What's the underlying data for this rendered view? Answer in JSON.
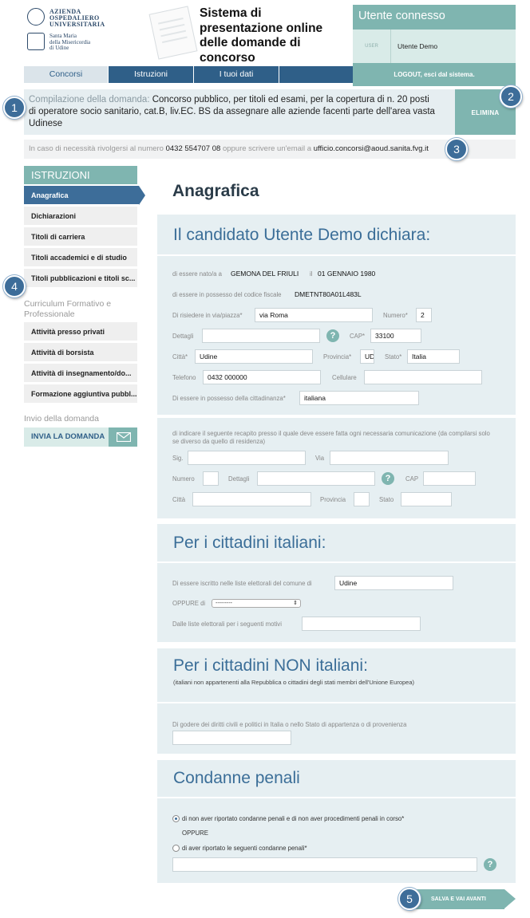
{
  "logo": {
    "org_lines": [
      "AZIENDA",
      "OSPEDALIERO",
      "UNIVERSITARIA"
    ],
    "hospital_lines": [
      "Santa Maria",
      "della Misericordia",
      "di Udine"
    ]
  },
  "app_title": "Sistema di presentazione online delle domande di concorso",
  "user_panel": {
    "title": "Utente connesso",
    "user_label": "USER",
    "user_name": "Utente Demo",
    "logout": "LOGOUT, esci dal sistema."
  },
  "tabs": [
    {
      "label": "Concorsi",
      "active": true
    },
    {
      "label": "Istruzioni",
      "active": false
    },
    {
      "label": "I tuoi dati",
      "active": false
    },
    {
      "label": "",
      "active": false
    }
  ],
  "notice": {
    "lead": "Compilazione della domanda:",
    "text": "Concorso pubblico, per titoli ed esami, per la copertura di n. 20 posti di operatore socio sanitario, cat.B, liv.EC. BS da assegnare alle aziende facenti parte dell'area vasta Udinese",
    "delete": "ELIMINA"
  },
  "contact": {
    "prefix": "In caso di necessità rivolgersi al numero",
    "phone": "0432 554707 08",
    "middle": "oppure scrivere un'email a",
    "email": "ufficio.concorsi@aoud.sanita.fvg.it"
  },
  "badges": [
    "1",
    "2",
    "3",
    "4",
    "5"
  ],
  "sidebar": {
    "header": "ISTRUZIONI",
    "items": [
      "Anagrafica",
      "Dichiarazioni",
      "Titoli di carriera",
      "Titoli accademici e di studio",
      "Titoli pubblicazioni e titoli sc..."
    ],
    "selected_index": 0,
    "curriculum_label": "Curriculum Formativo e Professionale",
    "curriculum_items": [
      "Attività presso privati",
      "Attività di borsista",
      "Attività di insegnamento/do...",
      "Formazione aggiuntiva pubbl..."
    ],
    "send_label": "Invio della domanda",
    "send_button": "INVIA LA DOMANDA"
  },
  "main": {
    "page_title": "Anagrafica",
    "section1": {
      "heading": "Il candidato Utente Demo dichiara:",
      "born_label": "di essere nato/a a",
      "born_place": "GEMONA DEL FRIULI",
      "born_il": "il",
      "born_date": "01 GENNAIO 1980",
      "cf_label": "di essere in possesso del codice fiscale",
      "cf_value": "DMETNT80A01L483L",
      "via_label": "Di risiedere in via/piazza*",
      "via_value": "via Roma",
      "numero_label": "Numero*",
      "numero_value": "2",
      "dettagli_label": "Dettagli",
      "dettagli_value": "",
      "cap_label": "CAP*",
      "cap_value": "33100",
      "citta_label": "Città*",
      "citta_value": "Udine",
      "provincia_label": "Provincia*",
      "provincia_value": "UD",
      "stato_label": "Stato*",
      "stato_value": "Italia",
      "telefono_label": "Telefono",
      "telefono_value": "0432 000000",
      "cellulare_label": "Cellulare",
      "cellulare_value": "",
      "cittadinanza_label": "Di essere in possesso della cittadinanza*",
      "cittadinanza_value": "italiana"
    },
    "section2": {
      "note": "di indicare il seguente recapito presso il quale deve essere fatta ogni necessaria comunicazione (da compilarsi solo se diverso da quello di residenza)",
      "sig_label": "Sig.",
      "via_label": "Via",
      "numero_label": "Numero",
      "dettagli_label": "Dettagli",
      "cap_label": "CAP",
      "citta_label": "Città",
      "provincia_label": "Provincia",
      "stato_label": "Stato"
    },
    "section3": {
      "heading": "Per i cittadini italiani:",
      "liste_label": "Di essere iscritto nelle liste elettorali del comune di",
      "liste_value": "Udine",
      "oppure_label": "OPPURE di",
      "oppure_value": "---------",
      "motivi_label": "Dalle liste elettorali per i seguenti motivi",
      "motivi_value": ""
    },
    "section4": {
      "heading": "Per i cittadini NON italiani:",
      "note": "(italiani non appartenenti alla Repubblica o cittadini degli stati membri dell'Unione Europea)",
      "diritti_label": "Di godere dei diritti civili e politici in Italia o nello Stato di appartenza o di provenienza",
      "diritti_value": ""
    },
    "section5": {
      "heading": "Condanne penali",
      "option1": "di non aver riportato condanne penali e di non aver procedimenti penali in corso*",
      "option1_checked": true,
      "oppure": "OPPURE",
      "option2": "di aver riportato le seguenti condanne penali*",
      "option2_checked": false,
      "condanne_value": ""
    },
    "save_button": "SALVA E VAI AVANTI"
  },
  "colors": {
    "teal": "#7fb5b0",
    "blue": "#3d6d99",
    "tabs_bg": "#2f5f88",
    "section_bg": "#e6eff2",
    "heading_blue": "#3b6e98"
  }
}
